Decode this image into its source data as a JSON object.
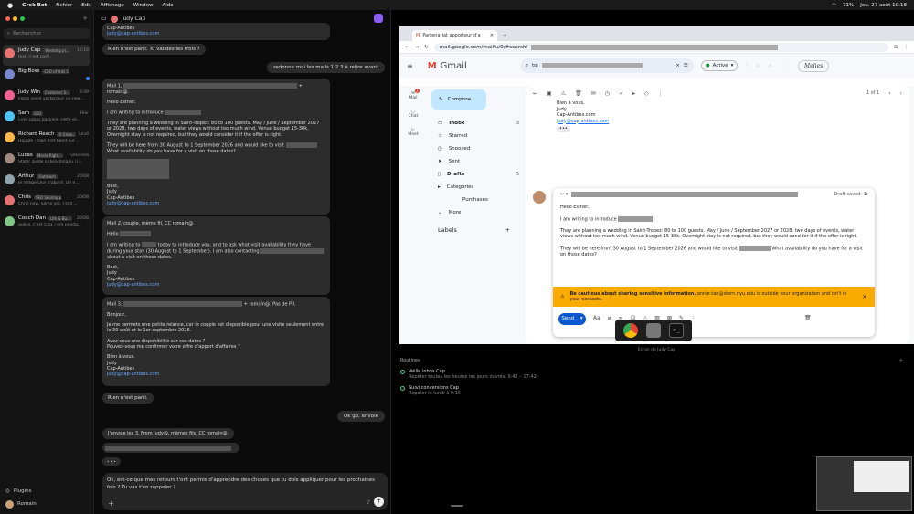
{
  "menubar": {
    "app": "Grok Bot",
    "items": [
      "Fichier",
      "Edit",
      "Affichage",
      "Window",
      "Aide"
    ],
    "battery": "71%",
    "clock": "Jeu. 27 août  10:18"
  },
  "sidebar": {
    "search_placeholder": "Rechercher",
    "conversations": [
      {
        "name": "Judy Cap",
        "tag": "Wedding pl...",
        "time": "10:16",
        "preview": "Rien n'est parti.",
        "color": "#e57373"
      },
      {
        "name": "Big Boss",
        "tag": "CEO of Yuki Capit...",
        "time": "",
        "preview": "",
        "color": "#7986cb"
      },
      {
        "name": "Judy Win",
        "tag": "Customer S...",
        "time": "9:49",
        "preview": "Inbox since yesterday: no new...",
        "color": "#f06292"
      },
      {
        "name": "Sam",
        "tag": "SEO",
        "time": "Hier",
        "preview": "Cinq cibles backlink cette se...",
        "color": "#4fc3f7"
      },
      {
        "name": "Richard Reach",
        "tag": "X Grow...",
        "time": "lundi",
        "preview": "Doublé : take first-hand sur ...",
        "color": "#ffb74d"
      },
      {
        "name": "Lucas",
        "tag": "Movie Right...",
        "time": "vendredi",
        "preview": "State: guide onboarding lu (1...",
        "color": "#a1887f"
      },
      {
        "name": "Arthur",
        "tag": "Outreach",
        "time": "20/08",
        "preview": "Je rédige Levi d'abord. On e...",
        "color": "#90a4ae"
      },
      {
        "name": "Chris",
        "tag": "SEO Scoring pl...",
        "time": "20/08",
        "preview": "Chris now. Same job. I still ...",
        "color": "#e57373"
      },
      {
        "name": "Coach Dan",
        "tag": "Life & Bu...",
        "time": "20/08",
        "preview": "Sub-4, c'est 5:41 / km penda...",
        "color": "#81c784"
      }
    ],
    "plugins": "Plugins",
    "user": "Romain"
  },
  "chat": {
    "title": "Judy Cap",
    "top_link": "judy@cap-antibes.com",
    "top_company": "Cap-Antibes",
    "bubble_rien": "Rien n'est parti. Tu valides les trois ?",
    "user1": "redonne moi les mails 1 2 3 à relire avant",
    "mail1": {
      "head": "Mail 1,",
      "head_tail": "+ romain@.",
      "greeting": "Hello Esther,",
      "intro": "I am writing to introduce",
      "body1": "They are planning a wedding in Saint-Tropez: 80 to 100 guests, May / June / September 2027 or 2028, two days of events, water views without too much wind. Venue budget 15-30k. Overnight stay is not required, but they would consider it if the offer is right.",
      "body2": "They will be here from 30 August to 1 September 2026 and would like to visit",
      "body2b": "What availability do you have for a visit on those dates?",
      "sign1": "Best,",
      "sign2": "Judy",
      "sign3": "Cap-Antibes",
      "email": "judy@cap-antibes.com"
    },
    "mail2": {
      "head": "Mail 2, couple, même fil, CC romain@.",
      "hello": "Hello",
      "body_a": "I am writing to",
      "body_b": "today to introduce you, and to ask what visit availability they have during your stay (30 August to 1 September). I am also contacting",
      "body_c": "about a visit on those dates.",
      "sign1": "Best,",
      "sign2": "Judy",
      "sign3": "Cap-Antibes",
      "email": "judy@cap-antibes.com"
    },
    "mail3": {
      "head": "Mail 3,",
      "head_tail": "+ romain@. Pas de PII.",
      "greeting": "Bonjour,",
      "body1": "Je me permets une petite relance, car le couple est disponible pour une visite seulement entre le 30 août et le 1er septembre 2026.",
      "body2": "Avez-vous une disponibilité sur ces dates ?",
      "body3": "Pouvez-vous me confirmer votre offre d'apport d'affaires ?",
      "sign1": "Bien à vous,",
      "sign2": "Judy",
      "sign3": "Cap-Antibes",
      "email": "judy@cap-antibes.com"
    },
    "bot_rien": "Rien n'est parti.",
    "user2": "Ok go, envoie",
    "bot_send": "J'envoie les 3. From judy@, mêmes fils, CC romain@.",
    "typing": "• • •",
    "composer": "Ok, est-ce que mes retours t'ont permis d'apprendre des choses que tu dois appliquer pour les prochaines fois ? Tu vas t'en rappeler ?"
  },
  "browser": {
    "tab_title": "Partenariat apporteur d'a",
    "url": "mail.google.com/mail/u/0/#search/",
    "gmail": "Gmail",
    "search_prefix": "to:",
    "status": "Active",
    "signature": "Melies",
    "rail": {
      "mail": "Mail",
      "chat": "Chat",
      "meet": "Meet",
      "badge": "3"
    },
    "compose": "Compose",
    "nav": [
      {
        "label": "Inbox",
        "count": "3",
        "bold": true
      },
      {
        "label": "Starred",
        "count": ""
      },
      {
        "label": "Snoozed",
        "count": ""
      },
      {
        "label": "Sent",
        "count": ""
      },
      {
        "label": "Drafts",
        "count": "5",
        "bold": true
      },
      {
        "label": "Categories",
        "count": ""
      },
      {
        "label": "Purchases",
        "count": ""
      },
      {
        "label": "More",
        "count": ""
      }
    ],
    "labels": "Labels",
    "pager": "1 of 1",
    "quoted": [
      "Bien à vous,",
      "Judy",
      "Cap-Antibes.com",
      "judy@cap-antibes.com"
    ],
    "draft_saved": "Draft saved",
    "draft": {
      "greeting": "Hello Esther,",
      "intro": "I am writing to introduce",
      "body1": "They are planning a wedding in Saint-Tropez: 80 to 100 guests, May / June / September 2027 or 2028, two days of events, water views without too much wind. Venue budget 15-30k. Overnight stay is not required, but they would consider it if the offer is right.",
      "body2": "They will be here from 30 August to 1 September 2026 and would like to visit",
      "body2b": "What availability do you have for a visit on those dates?"
    },
    "warning_bold": "Be cautious about sharing sensitive information.",
    "warning_text": "annie.tan@stern.nyu.edu is outside your organization and isn't in your contacts.",
    "send": "Send"
  },
  "screen_label": "Ecran de Judy Cap",
  "routines": {
    "title": "Routines",
    "items": [
      {
        "name": "Veille inbox Cap",
        "schedule": "Répéter toutes les heures les jours ouvrés, 9:42 – 17:42"
      },
      {
        "name": "Suivi conversions Cap",
        "schedule": "Répéter le lundi à 9:15"
      }
    ]
  }
}
